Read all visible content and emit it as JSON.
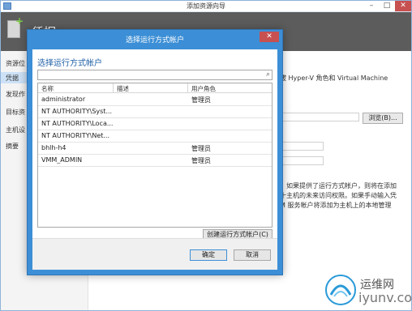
{
  "wizard": {
    "title": "添加资源向导",
    "header_title": "凭据",
    "nav": [
      "资源位",
      "凭据",
      "发现作",
      "目标资",
      "主机设",
      "摘要"
    ],
    "desc_line": "拔 Hyper-V 角色和 Virtual Machine",
    "browse_label": "浏览(B)...",
    "info_lines": [
      "，如果提供了运行方式帐户，则将在添加",
      "十主机的未来访问权限。如果手动输入凭",
      "M 服务帐户将添加为主机上的本地管理"
    ],
    "min_glyph": "–",
    "max_glyph": "□",
    "close_glyph": "✕"
  },
  "dialog": {
    "title": "选择运行方式帐户",
    "close_glyph": "✕",
    "heading": "选择运行方式帐户",
    "search": {
      "value": "",
      "icon": "search-icon",
      "glyph": "⌕"
    },
    "columns": [
      "名称",
      "描述",
      "用户角色"
    ],
    "rows": [
      {
        "name": "administrator",
        "desc": "",
        "role": "管理员"
      },
      {
        "name": "NT AUTHORITY\\Syst...",
        "desc": "",
        "role": ""
      },
      {
        "name": "NT AUTHORITY\\Loca...",
        "desc": "",
        "role": ""
      },
      {
        "name": "NT AUTHORITY\\Net...",
        "desc": "",
        "role": ""
      },
      {
        "name": "bhlh-h4",
        "desc": "",
        "role": "管理员"
      },
      {
        "name": "VMM_ADMIN",
        "desc": "",
        "role": "管理员"
      }
    ],
    "create_label": "创建运行方式帐户(C)",
    "ok_label": "确定",
    "cancel_label": "取消"
  },
  "watermark": {
    "cn": "运维网",
    "en": "iyunv.com"
  },
  "colors": {
    "accent": "#3c8fd6",
    "header_dark": "#5c5c5c",
    "heading_blue": "#1e5fa6",
    "close_red": "#c75050"
  }
}
